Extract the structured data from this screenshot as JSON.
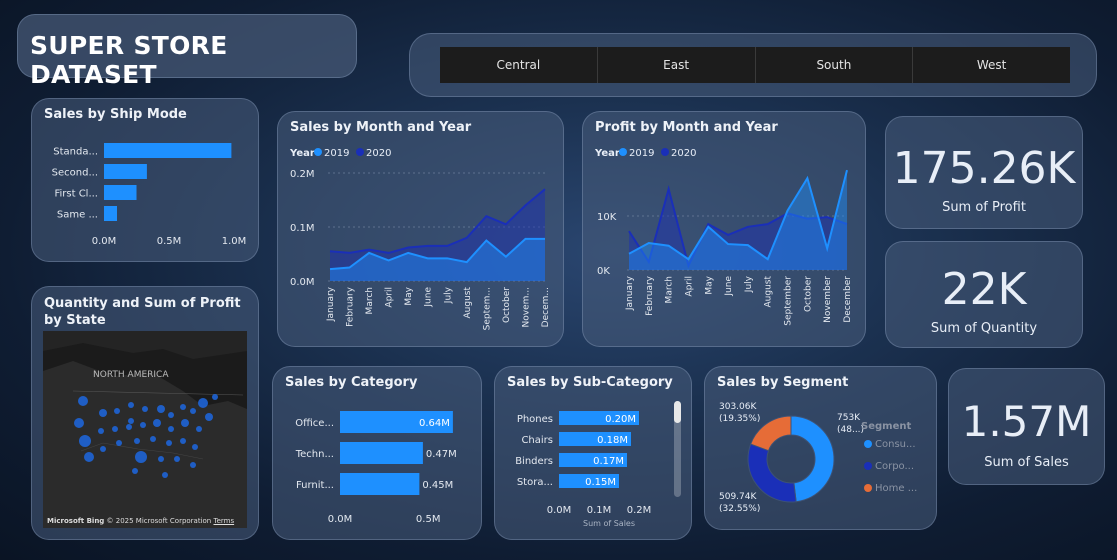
{
  "title": "SUPER STORE DATASET",
  "slicer": {
    "options": [
      "Central",
      "East",
      "South",
      "West"
    ]
  },
  "ship_mode": {
    "title": "Sales by Ship Mode",
    "chart_data": {
      "type": "bar",
      "categories": [
        "Standa...",
        "Second...",
        "First Cl...",
        "Same ..."
      ],
      "values": [
        0.98,
        0.33,
        0.25,
        0.1
      ],
      "ticks": [
        "0.0M",
        "0.5M",
        "1.0M"
      ],
      "xlim": [
        0,
        1.1
      ]
    }
  },
  "map": {
    "title": "Quantity and Sum of Profit by State",
    "label": "NORTH AMERICA",
    "credit_brand": "Microsoft Bing",
    "credit_copy": "© 2025 Microsoft Corporation",
    "credit_terms": "Terms"
  },
  "sales_month": {
    "title": "Sales by Month and Year",
    "legend_title": "Year",
    "chart_data": {
      "type": "area",
      "categories": [
        "January",
        "February",
        "March",
        "April",
        "May",
        "June",
        "July",
        "August",
        "Septem...",
        "October",
        "Novem...",
        "Decem..."
      ],
      "series": [
        {
          "name": "2019",
          "color": "#1e90ff",
          "values": [
            0.022,
            0.025,
            0.052,
            0.038,
            0.052,
            0.042,
            0.042,
            0.035,
            0.075,
            0.045,
            0.078,
            0.078
          ]
        },
        {
          "name": "2020",
          "color": "#1a2fb8",
          "values": [
            0.055,
            0.052,
            0.058,
            0.052,
            0.062,
            0.065,
            0.065,
            0.08,
            0.12,
            0.105,
            0.14,
            0.17
          ]
        }
      ],
      "ticks": [
        "0.0M",
        "0.1M",
        "0.2M"
      ],
      "ylim": [
        0,
        0.2
      ]
    }
  },
  "profit_month": {
    "title": "Profit by Month and Year",
    "legend_title": "Year",
    "chart_data": {
      "type": "area",
      "categories": [
        "January",
        "February",
        "March",
        "April",
        "May",
        "June",
        "July",
        "August",
        "September",
        "October",
        "November",
        "December"
      ],
      "series": [
        {
          "name": "2019",
          "color": "#1e90ff",
          "values": [
            3000,
            5000,
            4500,
            2000,
            8000,
            4800,
            4600,
            2000,
            11000,
            17000,
            4000,
            18500
          ]
        },
        {
          "name": "2020",
          "color": "#1a2fb8",
          "values": [
            7200,
            1500,
            15000,
            800,
            8500,
            6500,
            8000,
            8500,
            10500,
            9500,
            9800,
            8500
          ]
        }
      ],
      "ticks": [
        "0K",
        "10K"
      ],
      "ylim": [
        0,
        20000
      ]
    }
  },
  "kpi": {
    "profit_value": "175.26K",
    "profit_label": "Sum of Profit",
    "quantity_value": "22K",
    "quantity_label": "Sum of Quantity",
    "sales_value": "1.57M",
    "sales_label": "Sum of Sales"
  },
  "category": {
    "title": "Sales by Category",
    "chart_data": {
      "type": "bar",
      "categories": [
        "Office...",
        "Techn...",
        "Furnit..."
      ],
      "values": [
        0.64,
        0.47,
        0.45
      ],
      "labels": [
        "0.64M",
        "0.47M",
        "0.45M"
      ],
      "ticks": [
        "0.0M",
        "0.5M"
      ],
      "xlim": [
        0,
        0.72
      ]
    }
  },
  "subcategory": {
    "title": "Sales by Sub-Category",
    "xlabel": "Sum of Sales",
    "chart_data": {
      "type": "bar",
      "categories": [
        "Phones",
        "Chairs",
        "Binders",
        "Stora..."
      ],
      "values": [
        0.2,
        0.18,
        0.17,
        0.15
      ],
      "labels": [
        "0.20M",
        "0.18M",
        "0.17M",
        "0.15M"
      ],
      "ticks": [
        "0.0M",
        "0.1M",
        "0.2M"
      ],
      "xlim": [
        0,
        0.22
      ]
    }
  },
  "segment": {
    "title": "Sales by Segment",
    "legend_title": "Segment",
    "chart_data": {
      "type": "pie",
      "categories": [
        "Consu...",
        "Corpo...",
        "Home ..."
      ],
      "values": [
        48.1,
        32.55,
        19.35
      ],
      "colors": [
        "#1e90ff",
        "#1a2fb8",
        "#e66c37"
      ],
      "label_consumer": "753K",
      "label_consumer_pct": "(48...)",
      "label_corporate": "509.74K",
      "label_corporate_pct": "(32.55%)",
      "label_home": "303.06K",
      "label_home_pct": "(19.35%)"
    }
  }
}
